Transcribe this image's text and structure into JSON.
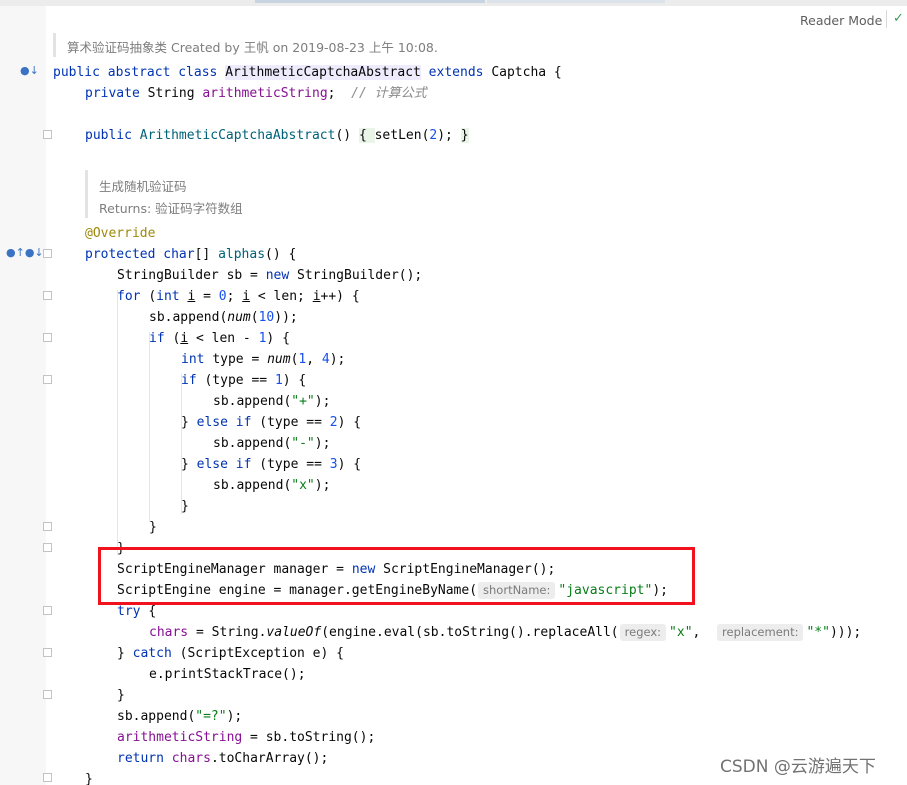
{
  "editor": {
    "reader_mode_label": "Reader Mode",
    "check_icon": "✓"
  },
  "doc_comments": {
    "class_doc": "算术验证码抽象类 Created by 王帆 on 2019-08-23 上午 10:08.",
    "method_doc_line1": "生成随机验证码",
    "method_doc_line2": "Returns: 验证码字符数组"
  },
  "code": {
    "l1": {
      "a": "public abstract class ",
      "b": "ArithmeticCaptchaAbstract",
      "c": " extends ",
      "d": "Captcha {"
    },
    "l2": {
      "a": "private ",
      "b": "String ",
      "c": "arithmeticString",
      "d": ";  ",
      "e": "// 计算公式"
    },
    "l3": {
      "a": "public ",
      "b": "ArithmeticCaptchaAbstract",
      "c": "() ",
      "d": "{ ",
      "e": "setLen",
      "f": "(",
      "g": "2",
      "h": "); ",
      "i": "}"
    },
    "l4": "@Override",
    "l5": {
      "a": "protected ",
      "b": "char",
      "c": "[] ",
      "d": "alphas",
      "e": "() {"
    },
    "l6": {
      "a": "StringBuilder sb = ",
      "b": "new ",
      "c": "StringBuilder();"
    },
    "l7": {
      "a": "for ",
      "b": "(",
      "c": "int ",
      "d": "i",
      "e": " = ",
      "f": "0",
      "g": "; ",
      "h": "i",
      "i": " < len; ",
      "j": "i",
      "k": "++) {"
    },
    "l8": {
      "a": "sb.append(",
      "b": "num",
      "c": "(",
      "d": "10",
      "e": "));"
    },
    "l9": {
      "a": "if ",
      "b": "(",
      "c": "i",
      "d": " < len - ",
      "e": "1",
      "f": ") {"
    },
    "l10": {
      "a": "int ",
      "b": "type = ",
      "c": "num",
      "d": "(",
      "e": "1",
      "f": ", ",
      "g": "4",
      "h": ");"
    },
    "l11": {
      "a": "if ",
      "b": "(type == ",
      "c": "1",
      "d": ") {"
    },
    "l12": {
      "a": "sb.append(",
      "b": "\"+\"",
      "c": ");"
    },
    "l13": {
      "a": "} ",
      "b": "else if ",
      "c": "(type == ",
      "d": "2",
      "e": ") {"
    },
    "l14": {
      "a": "sb.append(",
      "b": "\"-\"",
      "c": ");"
    },
    "l15": {
      "a": "} ",
      "b": "else if ",
      "c": "(type == ",
      "d": "3",
      "e": ") {"
    },
    "l16": {
      "a": "sb.append(",
      "b": "\"x\"",
      "c": ");"
    },
    "l17": "}",
    "l18": "}",
    "l19": "}",
    "l20": {
      "a": "ScriptEngineManager manager = ",
      "b": "new ",
      "c": "ScriptEngineManager();"
    },
    "l21": {
      "a": "ScriptEngine engine = manager.getEngineByName(",
      "hint": "shortName:",
      "b": "\"javascript\"",
      "c": ");"
    },
    "l22": {
      "a": "try ",
      "b": "{"
    },
    "l23": {
      "a": "chars",
      "b": " = String.",
      "c": "valueOf",
      "d": "(engine.eval(sb.toString().replaceAll(",
      "hint1": "regex:",
      "e": "\"x\"",
      "f": ",  ",
      "hint2": "replacement:",
      "g": "\"*\"",
      "h": ")));"
    },
    "l24": {
      "a": "} ",
      "b": "catch ",
      "c": "(ScriptException e) {"
    },
    "l25": "e.printStackTrace();",
    "l26": "}",
    "l27": {
      "a": "sb.append(",
      "b": "\"=?\"",
      "c": ");"
    },
    "l28": {
      "a": "arithmeticString",
      "b": " = sb.toString();"
    },
    "l29": {
      "a": "return ",
      "b": "chars",
      "c": ".toCharArray();"
    },
    "l30": "}"
  },
  "watermark": "CSDN @云游遍天下",
  "colors": {
    "keyword": "#0033b3",
    "field": "#871094",
    "number": "#1750eb",
    "string": "#067d17",
    "comment": "#8c8c8c",
    "annotation": "#9e880d",
    "highlight_box": "#f0131e"
  }
}
